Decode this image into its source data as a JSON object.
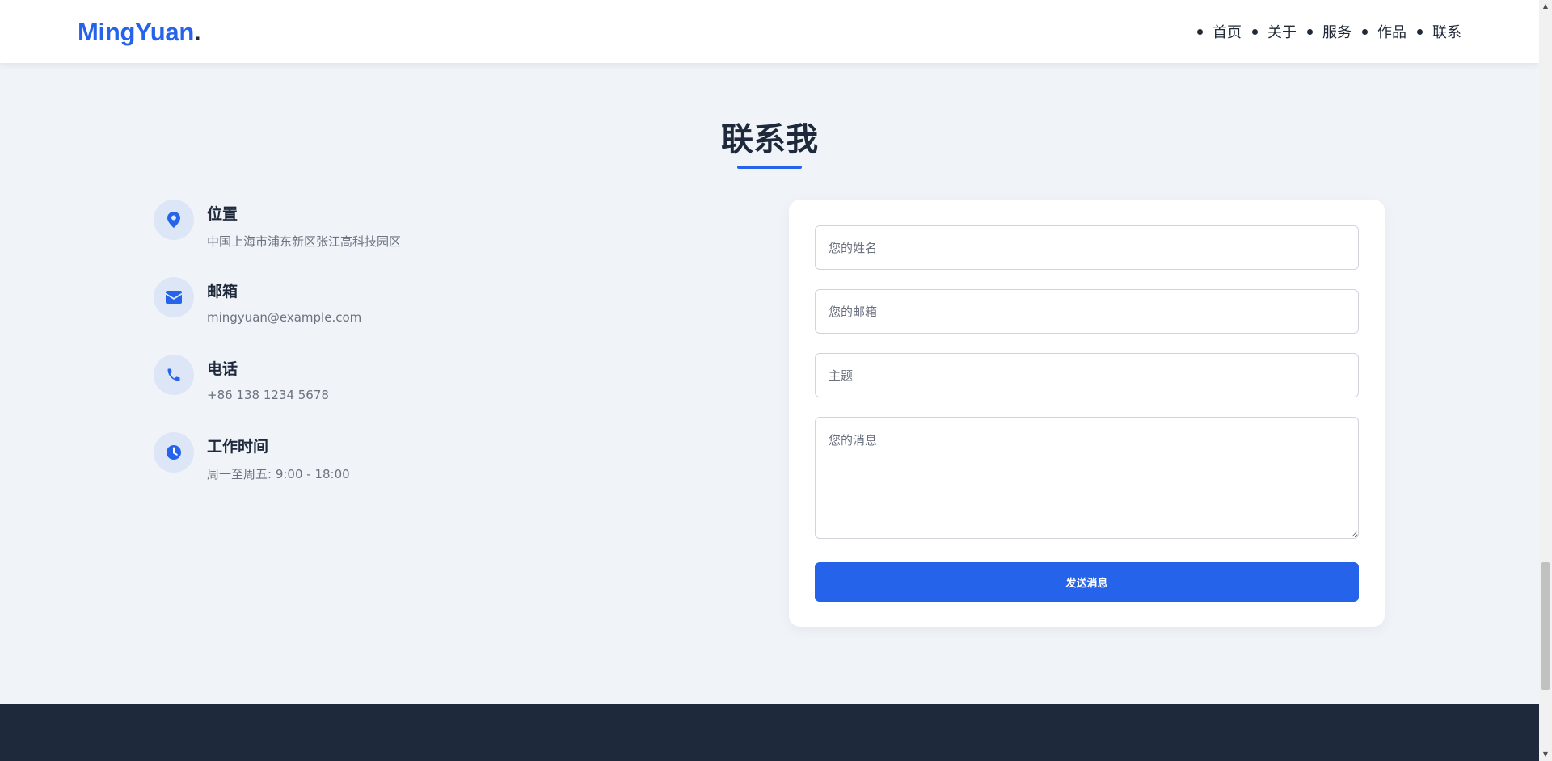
{
  "header": {
    "logo": "MingYuan",
    "logo_dot": ".",
    "nav": [
      "首页",
      "关于",
      "服务",
      "作品",
      "联系"
    ]
  },
  "contact": {
    "title": "联系我",
    "accent_color": "#2563eb",
    "items": [
      {
        "icon": "location-pin-icon",
        "title": "位置",
        "value": "中国上海市浦东新区张江高科技园区"
      },
      {
        "icon": "envelope-icon",
        "title": "邮箱",
        "value": "mingyuan@example.com"
      },
      {
        "icon": "phone-icon",
        "title": "电话",
        "value": "+86 138 1234 5678"
      },
      {
        "icon": "clock-icon",
        "title": "工作时间",
        "value": "周一至周五: 9:00 - 18:00"
      }
    ]
  },
  "form": {
    "name_placeholder": "您的姓名",
    "email_placeholder": "您的邮箱",
    "subject_placeholder": "主题",
    "message_placeholder": "您的消息",
    "submit_label": "发送消息"
  }
}
